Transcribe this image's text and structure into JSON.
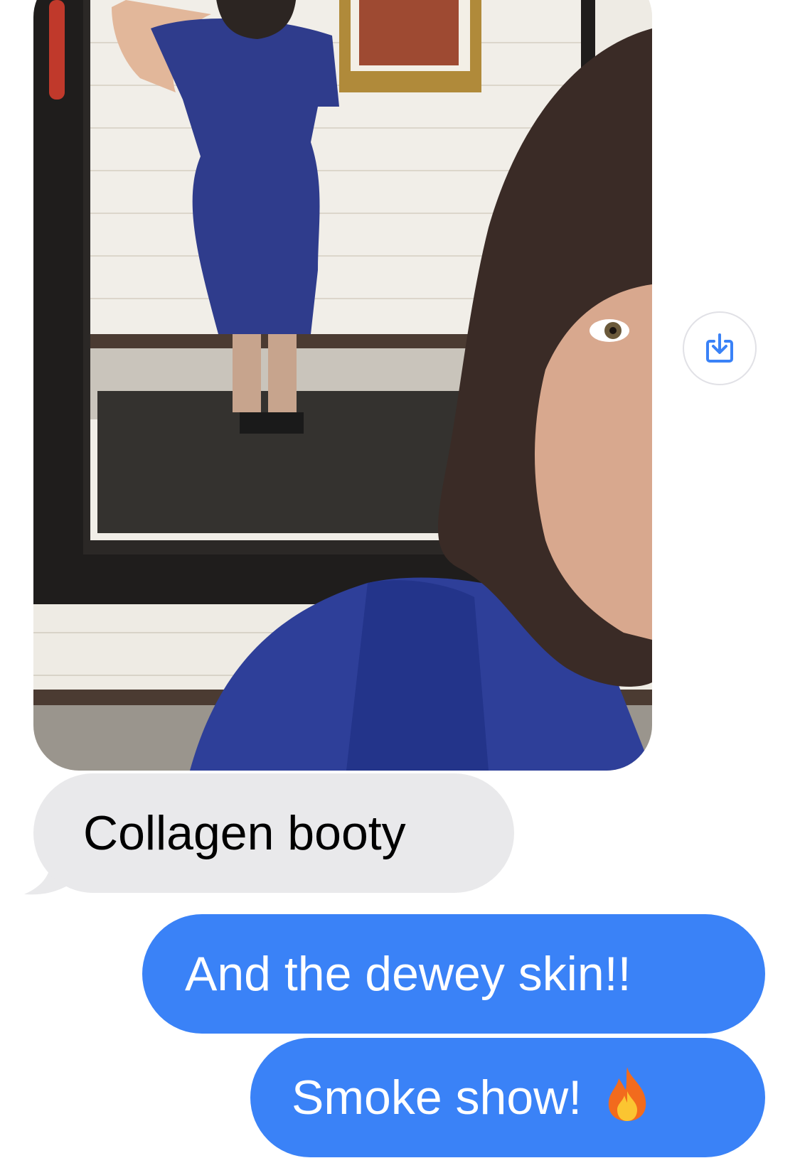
{
  "conversation": {
    "photo": {
      "alt": ""
    },
    "save_button": {
      "icon": "download-icon"
    },
    "messages": [
      {
        "direction": "received",
        "text": "Collagen booty"
      },
      {
        "direction": "sent",
        "text": "And the dewey skin!!"
      },
      {
        "direction": "sent",
        "text": "Smoke show!",
        "emoji": "🔥"
      }
    ]
  },
  "colors": {
    "sent_bubble": "#3a82f7",
    "received_bubble": "#e9e9eb",
    "save_icon": "#3a82f7"
  }
}
